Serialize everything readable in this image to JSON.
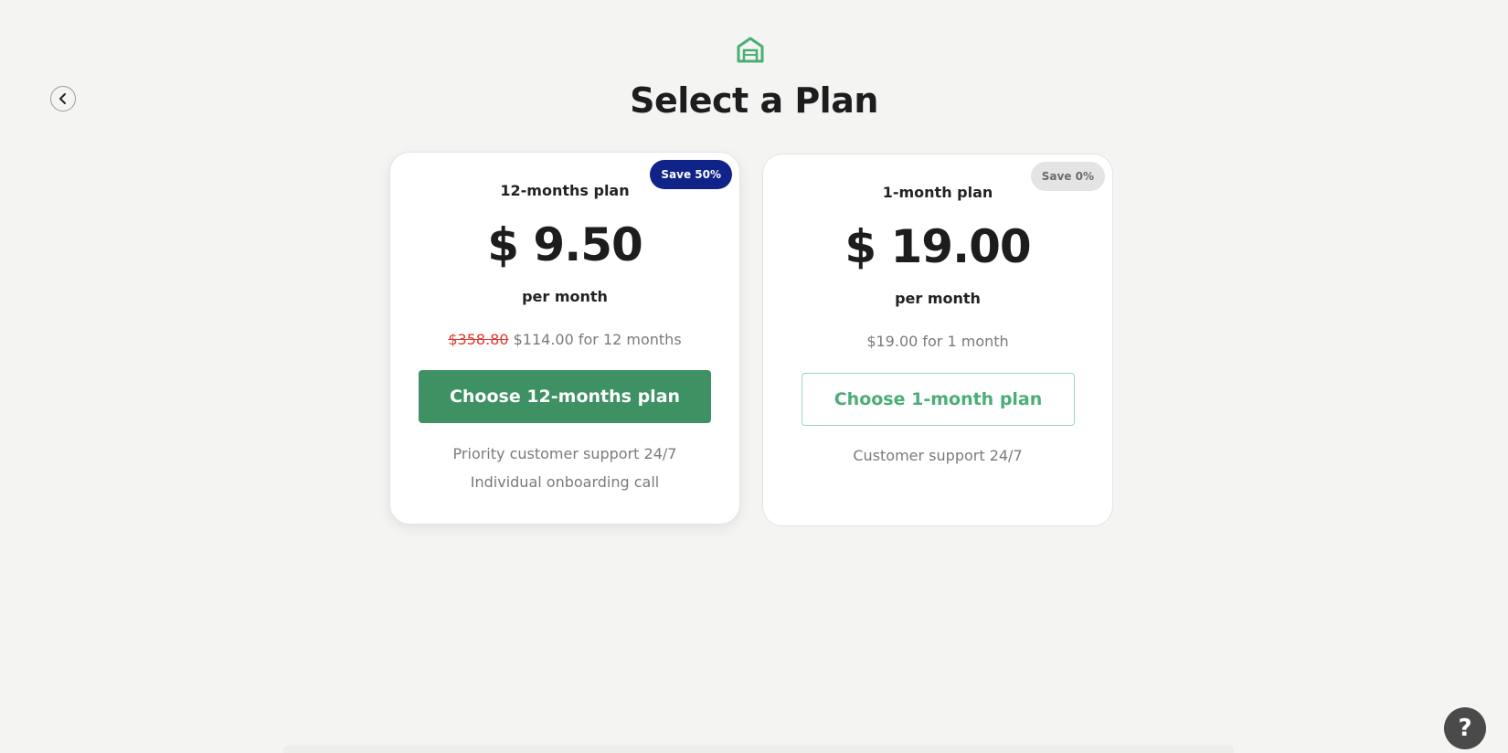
{
  "icons": {
    "logo": "garage-icon",
    "back": "chevron-left-icon",
    "help": "question-icon"
  },
  "colors": {
    "brand_green": "#3e9163",
    "outline_green": "#4aae75",
    "badge_navy": "#0f2389",
    "strike_red": "#e03a2f",
    "background": "#f4f5f2"
  },
  "header": {
    "title": "Select a Plan"
  },
  "plans": [
    {
      "name": "12-months plan",
      "badge": "Save 50%",
      "price": "$ 9.50",
      "period": "per month",
      "original_total": "$358.80",
      "total": "$114.00 for 12 months",
      "cta": "Choose 12-months plan",
      "features": [
        "Priority customer support 24/7",
        "Individual onboarding call"
      ]
    },
    {
      "name": "1-month plan",
      "badge": "Save 0%",
      "price": "$ 19.00",
      "period": "per month",
      "total": "$19.00 for 1 month",
      "cta": "Choose 1-month plan",
      "features": [
        "Customer support 24/7"
      ]
    }
  ],
  "help": {
    "label": "?"
  }
}
